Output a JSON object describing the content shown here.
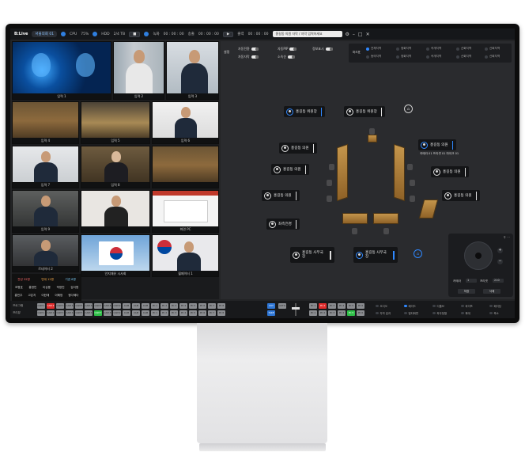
{
  "topbar": {
    "app_name": "B:Live",
    "session": "서울의회 01",
    "cpu_label": "CPU",
    "cpu_value": "75%",
    "hdd_label": "HDD",
    "hdd_value": "2/4 TB",
    "record_label": "녹화",
    "record_time": "00 : 00 : 00",
    "stream_label": "송출",
    "stream_time": "00 : 00 : 00",
    "onair_label": "출력",
    "onair_time": "00 : 00 : 00",
    "search_placeholder": "홍길동 의원 자막 / 자막 입력하세요"
  },
  "tiles": [
    {
      "label": "입력 1"
    },
    {
      "label": "입력 2"
    },
    {
      "label": "입력 3"
    },
    {
      "label": "입력 4"
    },
    {
      "label": "입력 5"
    },
    {
      "label": "입력 6"
    },
    {
      "label": "입력 7"
    },
    {
      "label": "입력 8"
    },
    {
      "label": ""
    },
    {
      "label": "입력 9"
    },
    {
      "label": ""
    },
    {
      "label": "화면 PC"
    },
    {
      "label": "인지재유 시사회"
    },
    {
      "label": "월페이터 1"
    },
    {
      "label": "르네이터 2"
    }
  ],
  "scoreboard": {
    "row1": [
      "찬성 32명",
      "반대 12명",
      "기권 6명"
    ],
    "row2": [
      "조병호",
      "홍현민",
      "이승용",
      "박정민",
      "김이명"
    ],
    "row3": [
      "홍민주",
      "고은지",
      "이한재",
      "이혜정",
      "정다혜다"
    ]
  },
  "options": {
    "title": "설정",
    "items": [
      "자동전환",
      "자동PIP",
      "정보표시",
      "자동자막",
      "소속순",
      "소속순"
    ]
  },
  "markers": {
    "title": "마크표",
    "items": [
      "전체지역",
      "정회지역",
      "속개지역",
      "산회지역",
      "산회지역",
      "동의지역",
      "정회지역",
      "속개지역",
      "산회지역",
      "산회지역"
    ]
  },
  "seats": [
    {
      "name": "홍길동 위원장",
      "active": true
    },
    {
      "name": "홍길동 위원장",
      "active": false
    },
    {
      "name": "홍길동 의원",
      "active": false
    },
    {
      "name": "홍길동 의원",
      "active": false
    },
    {
      "name": "홍길동 의원",
      "active": false
    },
    {
      "name": "홍길동 의원",
      "active": true
    },
    {
      "name": "홍길동 의원",
      "active": false
    },
    {
      "name": "홍길동 의원",
      "active": false
    },
    {
      "name": "좌측전경",
      "active": false
    },
    {
      "name": "홍길동 사무국장",
      "active": false
    },
    {
      "name": "홍길동 사무국장",
      "active": true
    }
  ],
  "seat_caption": "카메라 01  프리셋 01  마이크 01",
  "ptz": {
    "camera_label": "카메라",
    "camera_value": "1",
    "preset_label": "프리셋",
    "preset_value": "210",
    "save_label": "저장",
    "delete_label": "삭제"
  },
  "switcher": {
    "row1_label": "프로그램",
    "row2_label": "프리뷰",
    "cam_keys": [
      "CAM 1",
      "CAM 2",
      "CAM 3",
      "CAM 4",
      "CAM 5",
      "CAM 6",
      "CAM 7",
      "CAM 8",
      "CAM 9",
      "CAM 10",
      "CAM 11",
      "CAM 12"
    ],
    "aux_keys": [
      "PC 1",
      "PC 2",
      "PC 3",
      "PC 4",
      "PC 5",
      "PC 6",
      "PC 7",
      "PC 8"
    ],
    "effects": [
      "오디오",
      "페이드",
      "디졸브",
      "와이프",
      "페이딩",
      "자막 효과",
      "멀티화면",
      "좌우정렬",
      "확대",
      "축소"
    ]
  },
  "colors": {
    "accent": "#2f88ff",
    "program": "#e02c2c",
    "preview": "#2fbf48",
    "panel": "#232426"
  }
}
